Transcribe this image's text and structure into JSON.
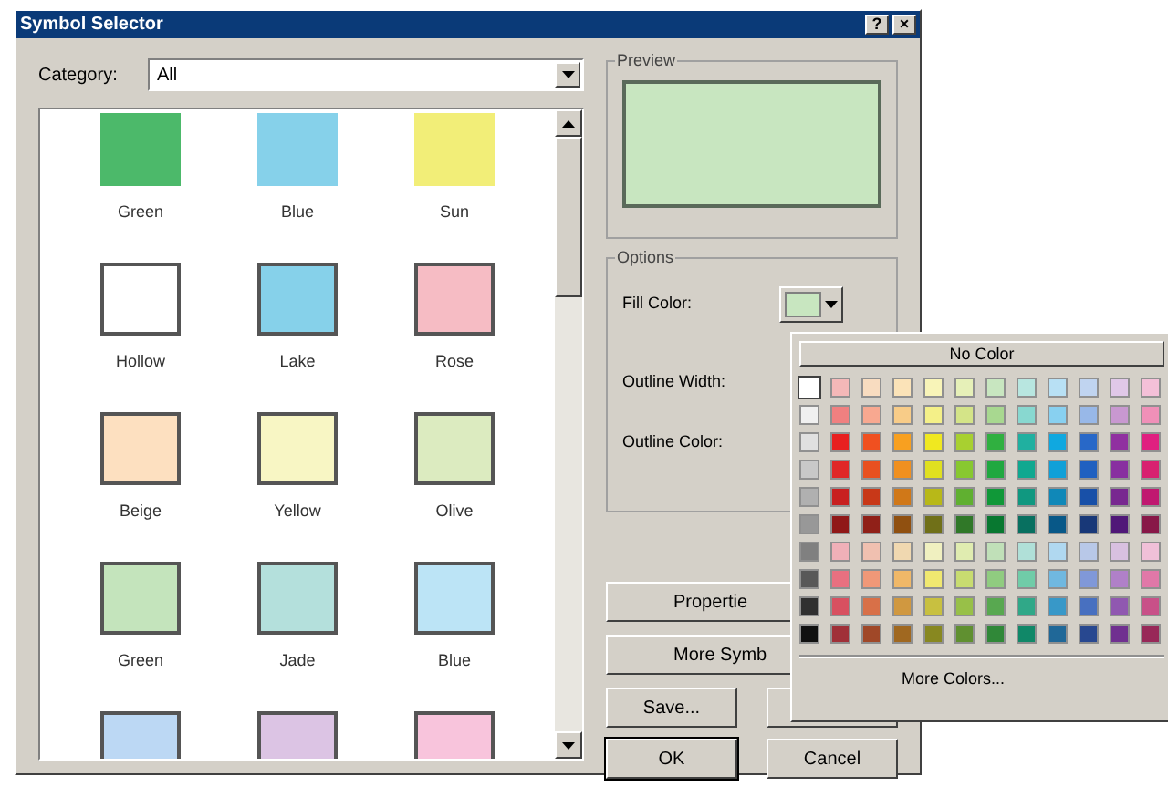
{
  "window": {
    "title": "Symbol Selector",
    "title_buttons": [
      "?",
      "×"
    ]
  },
  "category": {
    "label": "Category:",
    "value": "All"
  },
  "symbols": [
    {
      "label": "Green",
      "color": "#4cb96a",
      "outlined": false
    },
    {
      "label": "Blue",
      "color": "#86d1ea",
      "outlined": false
    },
    {
      "label": "Sun",
      "color": "#f2ee78",
      "outlined": false
    },
    {
      "label": "Hollow",
      "color": "#ffffff",
      "outlined": true
    },
    {
      "label": "Lake",
      "color": "#86d1ea",
      "outlined": true
    },
    {
      "label": "Rose",
      "color": "#f6bcc4",
      "outlined": true
    },
    {
      "label": "Beige",
      "color": "#fde0c0",
      "outlined": true
    },
    {
      "label": "Yellow",
      "color": "#f8f6c4",
      "outlined": true
    },
    {
      "label": "Olive",
      "color": "#dcebc0",
      "outlined": true
    },
    {
      "label": "Green",
      "color": "#c4e4bc",
      "outlined": true
    },
    {
      "label": "Jade",
      "color": "#b4e0dc",
      "outlined": true
    },
    {
      "label": "Blue",
      "color": "#bce4f6",
      "outlined": true
    },
    {
      "color": "#bcd8f4",
      "outlined": true
    },
    {
      "color": "#dcc4e4",
      "outlined": true
    },
    {
      "color": "#f8c4dc",
      "outlined": true
    }
  ],
  "preview": {
    "label": "Preview"
  },
  "options": {
    "label": "Options",
    "fill_color_label": "Fill Color:",
    "fill_swatch": {
      "color": "#c8e6c0"
    },
    "outline_width_label": "Outline Width:",
    "outline_color_label": "Outline Color:"
  },
  "buttons": {
    "properties": "Propertie",
    "more_symbols": "More Symb",
    "save": "Save...",
    "ok": "OK",
    "cancel": "Cancel"
  },
  "palette": {
    "no_color": "No Color",
    "more_colors": "More Colors...",
    "rows": [
      {
        "swatches": [
          {
            "color": "#ffffff",
            "selected": true
          },
          {
            "color": "#f4b8b8",
            "selected": false
          },
          {
            "color": "#f8dcc0",
            "selected": false
          },
          {
            "color": "#fbe3b8",
            "selected": false
          },
          {
            "color": "#f8f4b8",
            "selected": false
          },
          {
            "color": "#e6f0b8",
            "selected": false
          },
          {
            "color": "#c8e6c0",
            "selected": false
          },
          {
            "color": "#b8e6e0",
            "selected": false
          },
          {
            "color": "#b8e0f4",
            "selected": false
          },
          {
            "color": "#c0d4f0",
            "selected": false
          },
          {
            "color": "#e0c8e8",
            "selected": false
          },
          {
            "color": "#f4c0d8",
            "selected": false
          }
        ]
      },
      {
        "swatches": [
          {
            "color": "#f0f0f0",
            "selected": false
          },
          {
            "color": "#f08080",
            "selected": false
          },
          {
            "color": "#f8a890",
            "selected": false
          },
          {
            "color": "#f8cc88",
            "selected": false
          },
          {
            "color": "#f4f088",
            "selected": false
          },
          {
            "color": "#d4e488",
            "selected": false
          },
          {
            "color": "#a8d890",
            "selected": false
          },
          {
            "color": "#88d8d0",
            "selected": false
          },
          {
            "color": "#88d0f0",
            "selected": false
          },
          {
            "color": "#98b8e8",
            "selected": false
          },
          {
            "color": "#c898d0",
            "selected": false
          },
          {
            "color": "#f090b8",
            "selected": false
          }
        ]
      },
      {
        "swatches": [
          {
            "color": "#e0e0e0",
            "selected": false
          },
          {
            "color": "#e82020",
            "selected": false
          },
          {
            "color": "#f05020",
            "selected": false
          },
          {
            "color": "#f8a020",
            "selected": false
          },
          {
            "color": "#f0e820",
            "selected": false
          },
          {
            "color": "#a8d030",
            "selected": false
          },
          {
            "color": "#30b040",
            "selected": false
          },
          {
            "color": "#20b0a0",
            "selected": false
          },
          {
            "color": "#10a8e0",
            "selected": false
          },
          {
            "color": "#2868c8",
            "selected": false
          },
          {
            "color": "#9030a0",
            "selected": false
          },
          {
            "color": "#e02080",
            "selected": false
          }
        ]
      },
      {
        "swatches": [
          {
            "color": "#c8c8c8",
            "selected": false
          },
          {
            "color": "#e02828",
            "selected": false
          },
          {
            "color": "#e85020",
            "selected": false
          },
          {
            "color": "#f09020",
            "selected": false
          },
          {
            "color": "#e0e020",
            "selected": false
          },
          {
            "color": "#88c830",
            "selected": false
          },
          {
            "color": "#20a840",
            "selected": false
          },
          {
            "color": "#10a890",
            "selected": false
          },
          {
            "color": "#10a0d8",
            "selected": false
          },
          {
            "color": "#2060c0",
            "selected": false
          },
          {
            "color": "#8830a0",
            "selected": false
          },
          {
            "color": "#d82070",
            "selected": false
          }
        ]
      },
      {
        "swatches": [
          {
            "color": "#b0b0b0",
            "selected": false
          },
          {
            "color": "#c82020",
            "selected": false
          },
          {
            "color": "#c83818",
            "selected": false
          },
          {
            "color": "#d07818",
            "selected": false
          },
          {
            "color": "#b8b818",
            "selected": false
          },
          {
            "color": "#60b030",
            "selected": false
          },
          {
            "color": "#109838",
            "selected": false
          },
          {
            "color": "#109880",
            "selected": false
          },
          {
            "color": "#1088b8",
            "selected": false
          },
          {
            "color": "#1850a8",
            "selected": false
          },
          {
            "color": "#782890",
            "selected": false
          },
          {
            "color": "#c01870",
            "selected": false
          }
        ]
      },
      {
        "swatches": [
          {
            "color": "#989898",
            "selected": false
          },
          {
            "color": "#901818",
            "selected": false
          },
          {
            "color": "#902018",
            "selected": false
          },
          {
            "color": "#905010",
            "selected": false
          },
          {
            "color": "#707018",
            "selected": false
          },
          {
            "color": "#307828",
            "selected": false
          },
          {
            "color": "#087830",
            "selected": false
          },
          {
            "color": "#087060",
            "selected": false
          },
          {
            "color": "#085888",
            "selected": false
          },
          {
            "color": "#183878",
            "selected": false
          },
          {
            "color": "#501878",
            "selected": false
          },
          {
            "color": "#881848",
            "selected": false
          }
        ]
      },
      {
        "swatches": [
          {
            "color": "#808080",
            "selected": false
          },
          {
            "color": "#f0b0b8",
            "selected": false
          },
          {
            "color": "#f0c0b0",
            "selected": false
          },
          {
            "color": "#f0d8b0",
            "selected": false
          },
          {
            "color": "#f0f0c0",
            "selected": false
          },
          {
            "color": "#e0ecb0",
            "selected": false
          },
          {
            "color": "#c0e0b8",
            "selected": false
          },
          {
            "color": "#b0e0d8",
            "selected": false
          },
          {
            "color": "#b0d8f0",
            "selected": false
          },
          {
            "color": "#b8c8e8",
            "selected": false
          },
          {
            "color": "#d8c0e0",
            "selected": false
          },
          {
            "color": "#f0c0d8",
            "selected": false
          }
        ]
      },
      {
        "swatches": [
          {
            "color": "#585858",
            "selected": false
          },
          {
            "color": "#e87080",
            "selected": false
          },
          {
            "color": "#f09878",
            "selected": false
          },
          {
            "color": "#f0b868",
            "selected": false
          },
          {
            "color": "#f0e870",
            "selected": false
          },
          {
            "color": "#c8dc70",
            "selected": false
          },
          {
            "color": "#90cc80",
            "selected": false
          },
          {
            "color": "#70cca8",
            "selected": false
          },
          {
            "color": "#70b8e0",
            "selected": false
          },
          {
            "color": "#8098d8",
            "selected": false
          },
          {
            "color": "#b080c8",
            "selected": false
          },
          {
            "color": "#e078a8",
            "selected": false
          }
        ]
      },
      {
        "swatches": [
          {
            "color": "#303030",
            "selected": false
          },
          {
            "color": "#d85060",
            "selected": false
          },
          {
            "color": "#d87048",
            "selected": false
          },
          {
            "color": "#d09840",
            "selected": false
          },
          {
            "color": "#c8c040",
            "selected": false
          },
          {
            "color": "#98c048",
            "selected": false
          },
          {
            "color": "#58a850",
            "selected": false
          },
          {
            "color": "#30a888",
            "selected": false
          },
          {
            "color": "#3898c8",
            "selected": false
          },
          {
            "color": "#4870c0",
            "selected": false
          },
          {
            "color": "#9058b0",
            "selected": false
          },
          {
            "color": "#c85088",
            "selected": false
          }
        ]
      },
      {
        "swatches": [
          {
            "color": "#101010",
            "selected": false
          },
          {
            "color": "#a03038",
            "selected": false
          },
          {
            "color": "#a04828",
            "selected": false
          },
          {
            "color": "#a06820",
            "selected": false
          },
          {
            "color": "#888820",
            "selected": false
          },
          {
            "color": "#609030",
            "selected": false
          },
          {
            "color": "#308838",
            "selected": false
          },
          {
            "color": "#108868",
            "selected": false
          },
          {
            "color": "#206898",
            "selected": false
          },
          {
            "color": "#284890",
            "selected": false
          },
          {
            "color": "#703090",
            "selected": false
          },
          {
            "color": "#982858",
            "selected": false
          }
        ]
      }
    ]
  }
}
